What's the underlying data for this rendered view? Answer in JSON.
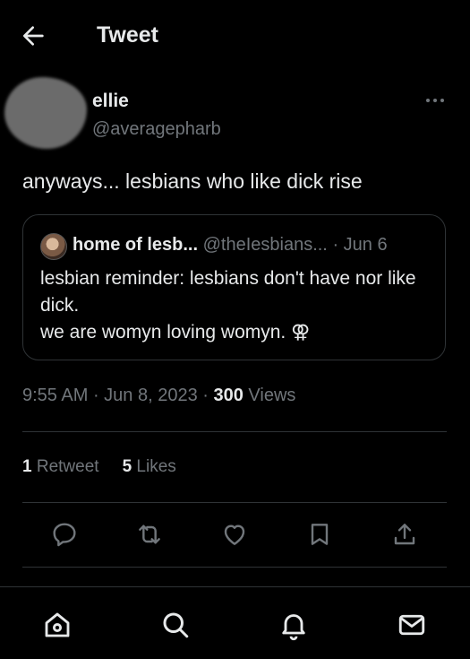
{
  "header": {
    "title": "Tweet",
    "back_icon": "arrow-left-icon"
  },
  "author": {
    "name": "ellie",
    "handle": "@averagepharb"
  },
  "tweet": {
    "text": "anyways... lesbians who like dick rise"
  },
  "quote": {
    "name": "home of lesb...",
    "handle": "@theIesbians...",
    "date": "· Jun 6",
    "text": "lesbian reminder: lesbians don't have nor like dick.\nwe are womyn loving womyn. ⚢"
  },
  "meta": {
    "time": "9:55 AM",
    "date": "Jun 8, 2023",
    "views_count": "300",
    "views_label": "Views"
  },
  "stats": {
    "retweets_count": "1",
    "retweets_label": "Retweet",
    "likes_count": "5",
    "likes_label": "Likes"
  },
  "actions": [
    "reply-icon",
    "retweet-icon",
    "like-icon",
    "bookmark-icon",
    "share-icon"
  ],
  "nav": [
    "home-icon",
    "search-icon",
    "notifications-icon",
    "messages-icon"
  ],
  "colors": {
    "background": "#000000",
    "text": "#e7e9ea",
    "secondary": "#71767b",
    "divider": "#2f3336"
  }
}
